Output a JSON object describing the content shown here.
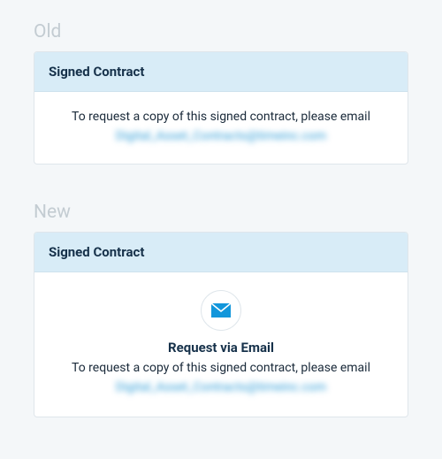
{
  "sections": {
    "old": {
      "label": "Old",
      "card": {
        "title": "Signed Contract",
        "body_text": "To request a copy of this signed contract, please email",
        "email_blurred": "Digital_Asset_Contracts@timeinc.com"
      }
    },
    "new": {
      "label": "New",
      "card": {
        "title": "Signed Contract",
        "subhead": "Request via Email",
        "body_text": "To request a copy of this signed contract, please email",
        "email_blurred": "Digital_Asset_Contracts@timeinc.com",
        "icon": "email-icon"
      }
    }
  },
  "colors": {
    "page_bg": "#f4f7f9",
    "card_header_bg": "#d8ecf7",
    "accent": "#1296db",
    "muted_label": "#c3ccd2",
    "link": "#2b9bd6"
  }
}
